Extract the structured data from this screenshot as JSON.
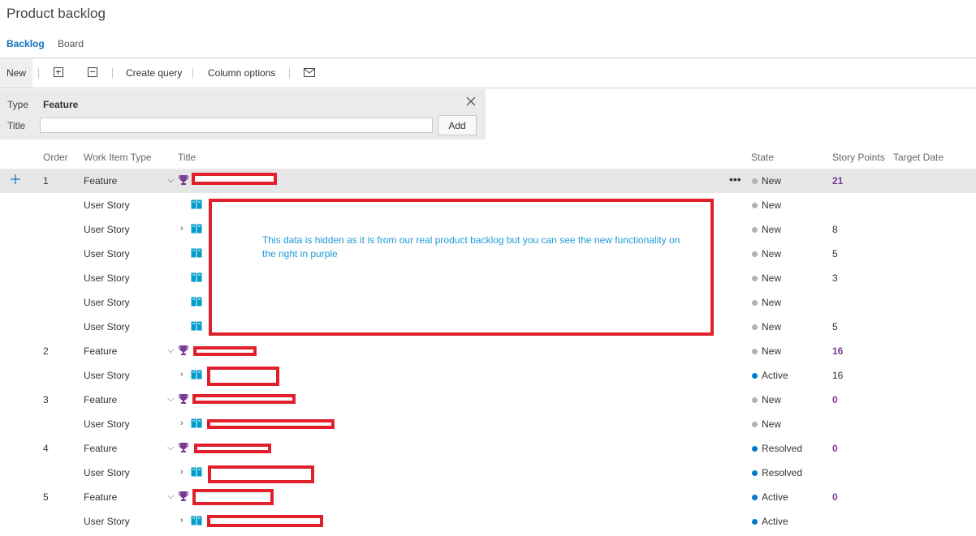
{
  "page": {
    "title": "Product backlog"
  },
  "pivot": {
    "tabs": [
      {
        "label": "Backlog"
      },
      {
        "label": "Board"
      }
    ]
  },
  "toolbar": {
    "new_label": "New",
    "expand_icon": "expand-all-icon",
    "collapse_icon": "collapse-all-icon",
    "create_query_label": "Create query",
    "column_options_label": "Column options",
    "mail_icon": "mail-icon"
  },
  "add_panel": {
    "type_label": "Type",
    "type_value": "Feature",
    "title_label": "Title",
    "title_value": "",
    "add_button": "Add"
  },
  "grid": {
    "headers": {
      "order": "Order",
      "work_item_type": "Work Item Type",
      "title": "Title",
      "state": "State",
      "story_points": "Story Points",
      "target_date": "Target Date"
    },
    "rows": [
      {
        "order": "1",
        "type": "Feature",
        "state": "New",
        "story_points": "21"
      },
      {
        "order": "",
        "type": "User Story",
        "state": "New",
        "story_points": ""
      },
      {
        "order": "",
        "type": "User Story",
        "state": "New",
        "story_points": "8"
      },
      {
        "order": "",
        "type": "User Story",
        "state": "New",
        "story_points": "5"
      },
      {
        "order": "",
        "type": "User Story",
        "state": "New",
        "story_points": "3"
      },
      {
        "order": "",
        "type": "User Story",
        "state": "New",
        "story_points": ""
      },
      {
        "order": "",
        "type": "User Story",
        "state": "New",
        "story_points": "5"
      },
      {
        "order": "2",
        "type": "Feature",
        "state": "New",
        "story_points": "16"
      },
      {
        "order": "",
        "type": "User Story",
        "state": "Active",
        "story_points": "16"
      },
      {
        "order": "3",
        "type": "Feature",
        "state": "New",
        "story_points": "0"
      },
      {
        "order": "",
        "type": "User Story",
        "state": "New",
        "story_points": ""
      },
      {
        "order": "4",
        "type": "Feature",
        "state": "Resolved",
        "story_points": "0"
      },
      {
        "order": "",
        "type": "User Story",
        "state": "Resolved",
        "story_points": ""
      },
      {
        "order": "5",
        "type": "Feature",
        "state": "Active",
        "story_points": "0"
      },
      {
        "order": "",
        "type": "User Story",
        "state": "Active",
        "story_points": ""
      }
    ]
  },
  "note": {
    "text": "This data is hidden as it is from our real product backlog but you can see the new functionality on the right in purple"
  },
  "colors": {
    "accent": "#106ebe",
    "rollup_purple": "#773b93",
    "state_new": "#b2b2b2",
    "state_active": "#007acc",
    "state_resolved": "#007acc",
    "redaction": "#e0212b",
    "note_text": "#1e9bd7"
  }
}
